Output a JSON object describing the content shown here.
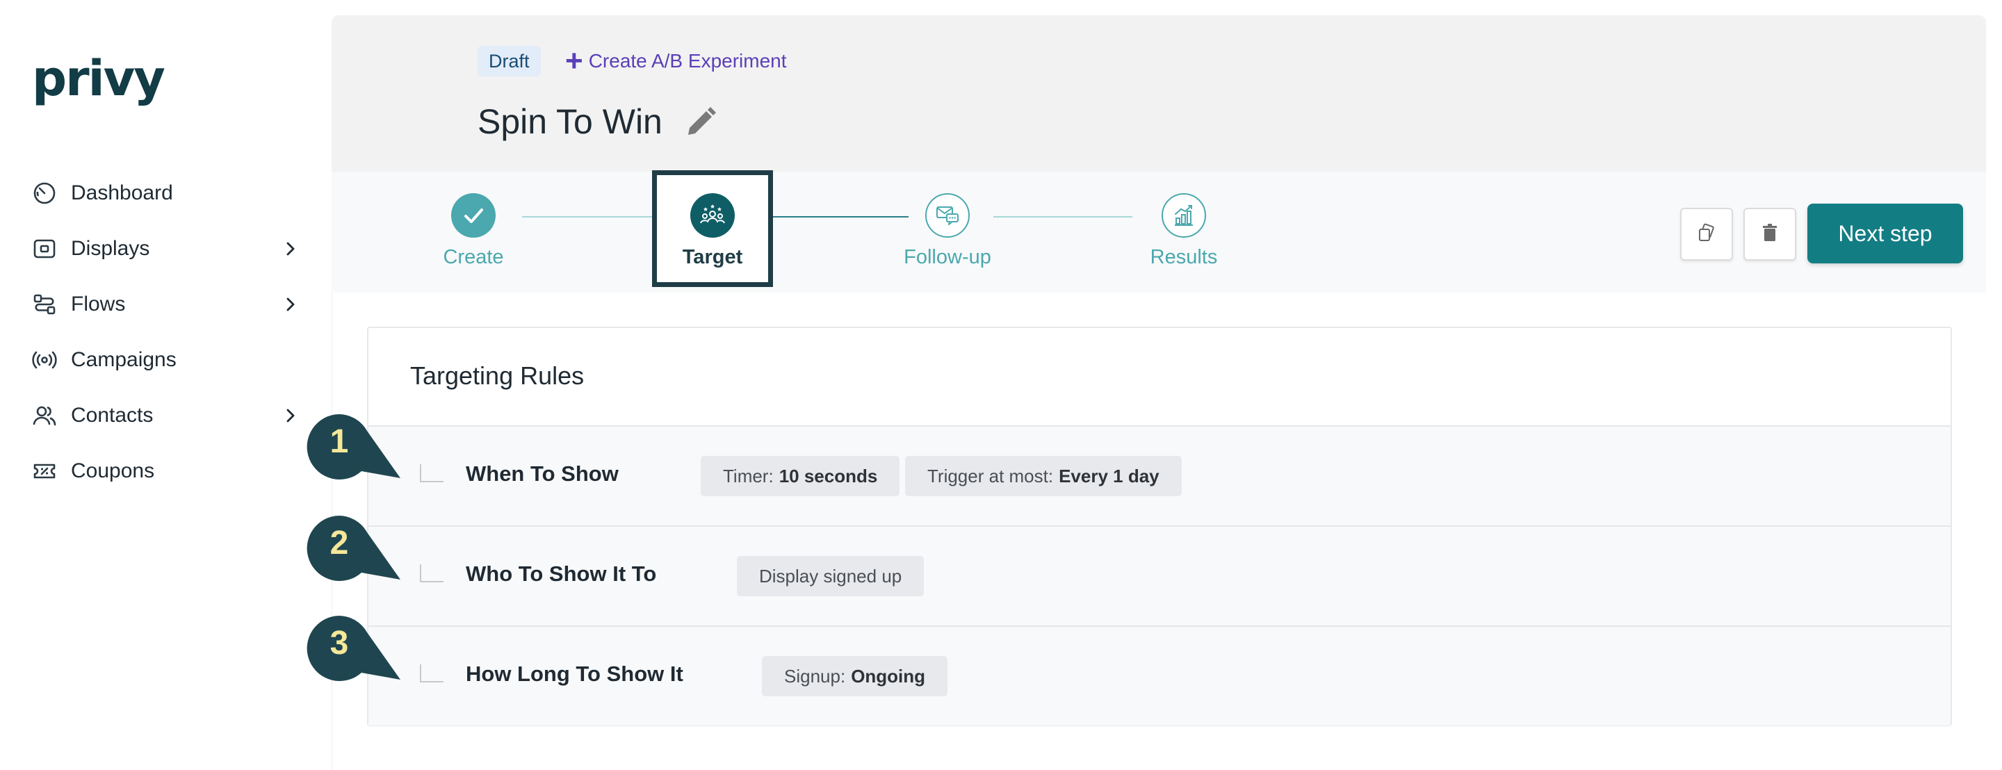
{
  "brand": {
    "logo": "privy"
  },
  "sidebar": {
    "items": [
      {
        "label": "Dashboard",
        "icon": "gauge-icon",
        "has_children": false
      },
      {
        "label": "Displays",
        "icon": "display-icon",
        "has_children": true
      },
      {
        "label": "Flows",
        "icon": "flows-icon",
        "has_children": true
      },
      {
        "label": "Campaigns",
        "icon": "broadcast-icon",
        "has_children": false
      },
      {
        "label": "Contacts",
        "icon": "users-icon",
        "has_children": true
      },
      {
        "label": "Coupons",
        "icon": "ticket-icon",
        "has_children": false
      }
    ]
  },
  "header": {
    "status_badge": "Draft",
    "ab_link": "Create A/B Experiment",
    "title": "Spin To Win"
  },
  "stepper": {
    "steps": [
      {
        "label": "Create",
        "state": "complete"
      },
      {
        "label": "Target",
        "state": "active"
      },
      {
        "label": "Follow-up",
        "state": "pending"
      },
      {
        "label": "Results",
        "state": "pending"
      }
    ],
    "next_label": "Next step"
  },
  "rules": {
    "title": "Targeting Rules",
    "rows": [
      {
        "number": "1",
        "title": "When To Show",
        "chips": [
          {
            "key": "Timer:",
            "value": "10 seconds"
          },
          {
            "key": "Trigger at most:",
            "value": "Every 1 day"
          }
        ]
      },
      {
        "number": "2",
        "title": "Who To Show It To",
        "chips": [
          {
            "key": "Display signed up",
            "value": ""
          }
        ]
      },
      {
        "number": "3",
        "title": "How Long To Show It",
        "chips": [
          {
            "key": "Signup:",
            "value": "Ongoing"
          }
        ]
      }
    ]
  },
  "colors": {
    "brand_teal": "#137d84",
    "callout_fill": "#1f4650",
    "callout_text": "#f5e89a",
    "link_purple": "#5a3fb8"
  }
}
